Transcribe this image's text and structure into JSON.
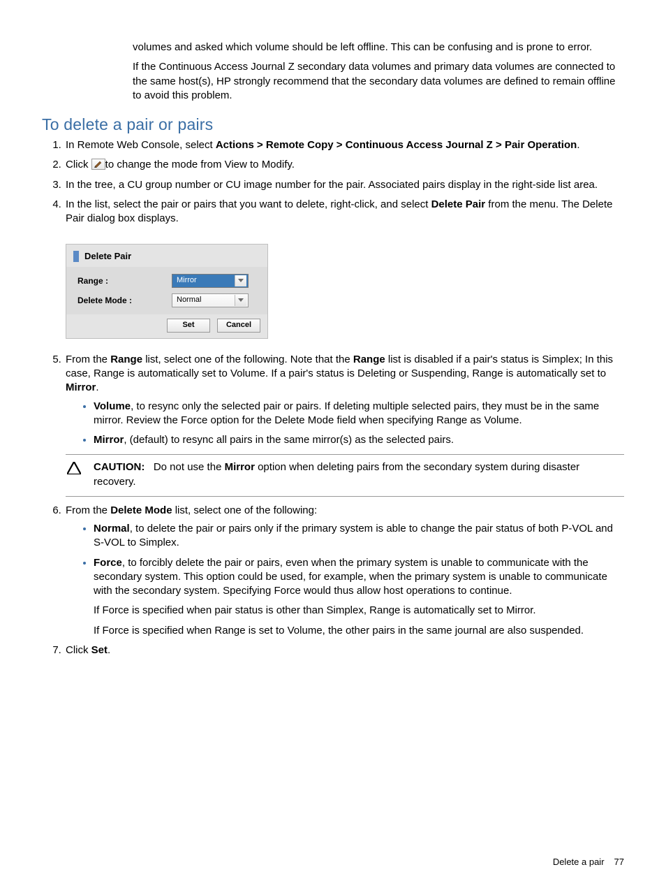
{
  "intro": {
    "para1": "volumes and asked which volume should be left offline. This can be confusing and is prone to error.",
    "para2": "If the Continuous Access Journal Z secondary data volumes and primary data volumes are connected to the same host(s), HP strongly recommend that the secondary data volumes are defined to remain offline to avoid this problem."
  },
  "heading": "To delete a pair or pairs",
  "steps": {
    "s1_pre": "In Remote Web Console, select ",
    "s1_bold": "Actions > Remote Copy > Continuous Access Journal Z > Pair Operation",
    "s1_post": ".",
    "s2_pre": "Click ",
    "s2_post": "to change the mode from View to Modify.",
    "s3": "In the tree, a CU group number or CU image number for the pair. Associated pairs display in the right-side list area.",
    "s4_pre": "In the list, select the pair or pairs that you want to delete, right-click, and select ",
    "s4_bold": "Delete Pair",
    "s4_post": " from the menu. The Delete Pair dialog box displays.",
    "s5_pre": "From the ",
    "s5_b1": "Range",
    "s5_mid1": " list, select one of the following. Note that the ",
    "s5_b2": "Range",
    "s5_mid2": " list is disabled if a pair's status is Simplex; In this case, Range is automatically set to Volume. If a pair's status is Deleting or Suspending, Range is automatically set to ",
    "s5_b3": "Mirror",
    "s5_post": ".",
    "s5_vol_b": "Volume",
    "s5_vol_t": ", to resync only the selected pair or pairs. If deleting multiple selected pairs, they must be in the same mirror. Review the Force option for the Delete Mode field when specifying Range as Volume.",
    "s5_mir_b": "Mirror",
    "s5_mir_t": ", (default) to resync all pairs in the same mirror(s) as the selected pairs.",
    "caution_label": "CAUTION:",
    "caution_pre": "Do not use the ",
    "caution_b": "Mirror",
    "caution_post": " option when deleting pairs from the secondary system during disaster recovery.",
    "s6_pre": "From the ",
    "s6_b": "Delete Mode",
    "s6_post": " list, select one of the following:",
    "s6_norm_b": "Normal",
    "s6_norm_t": ", to delete the pair or pairs only if the primary system is able to change the pair status of both P-VOL and S-VOL to Simplex.",
    "s6_force_b": "Force",
    "s6_force_t": ", to forcibly delete the pair or pairs, even when the primary system is unable to communicate with the secondary system. This option could be used, for example, when the primary system is unable to communicate with the secondary system. Specifying Force would thus allow host operations to continue.",
    "s6_force_p2": "If Force is specified when pair status is other than Simplex, Range is automatically set to Mirror.",
    "s6_force_p3": "If Force is specified when Range is set to Volume, the other pairs in the same journal are also suspended.",
    "s7_pre": "Click ",
    "s7_b": "Set",
    "s7_post": "."
  },
  "dialog": {
    "title": "Delete Pair",
    "range_label": "Range :",
    "range_value": "Mirror",
    "mode_label": "Delete Mode :",
    "mode_value": "Normal",
    "set": "Set",
    "cancel": "Cancel"
  },
  "footer": {
    "section": "Delete a pair",
    "page": "77"
  }
}
